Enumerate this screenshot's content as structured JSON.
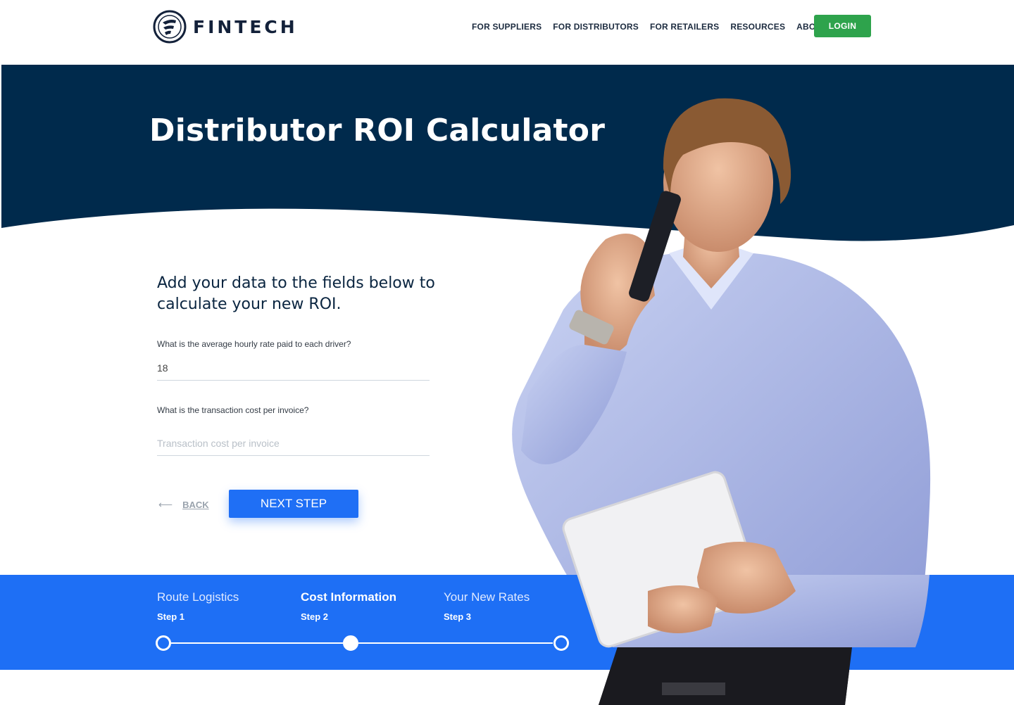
{
  "brand": {
    "name": "FINTECH",
    "logo_icon": "fintech-logo-icon"
  },
  "nav": {
    "items": [
      {
        "label": "FOR SUPPLIERS"
      },
      {
        "label": "FOR DISTRIBUTORS"
      },
      {
        "label": "FOR RETAILERS"
      },
      {
        "label": "RESOURCES"
      },
      {
        "label": "ABOUT"
      }
    ],
    "login_label": "LOGIN"
  },
  "hero": {
    "title": "Distributor ROI Calculator"
  },
  "form": {
    "intro": "Add your data to the fields below to calculate your new ROI.",
    "fields": [
      {
        "label": "What is the average hourly rate paid to each driver?",
        "value": "18",
        "placeholder": ""
      },
      {
        "label": "What is the transaction cost per invoice?",
        "value": "",
        "placeholder": "Transaction cost per invoice"
      }
    ],
    "back_label": "BACK",
    "back_icon": "arrow-left-icon",
    "next_label": "NEXT STEP"
  },
  "steps": {
    "items": [
      {
        "title": "Route Logistics",
        "sub": "Step 1",
        "active": false
      },
      {
        "title": "Cost Information",
        "sub": "Step 2",
        "active": true
      },
      {
        "title": "Your New Rates",
        "sub": "Step 3",
        "active": false
      }
    ],
    "current_step": 2
  },
  "colors": {
    "navy": "#002a4c",
    "accent_blue": "#1e6ff5",
    "login_green": "#2ea34c"
  }
}
